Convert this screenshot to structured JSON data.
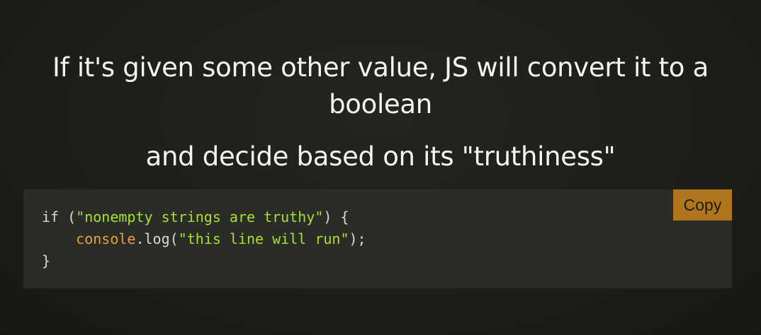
{
  "slide": {
    "heading": "If it's given some other value, JS will convert it to a boolean",
    "subheading": "and decide based on its \"truthiness\""
  },
  "code_block": {
    "copy_label": "Copy",
    "lines": [
      {
        "kw": "if",
        "p1": " (",
        "str": "\"nonempty strings are truthy\"",
        "p2": ") {"
      },
      {
        "indent": "    ",
        "obj": "console",
        "dot": ".",
        "method": "log",
        "p1": "(",
        "str": "\"this line will run\"",
        "p2": ");"
      },
      {
        "p": "}"
      }
    ]
  },
  "colors": {
    "background": "#1d1d1a",
    "code_background": "#2b2b28",
    "copy_button": "#b0761e",
    "string": "#a6e22e",
    "function": "#e6a23c"
  }
}
